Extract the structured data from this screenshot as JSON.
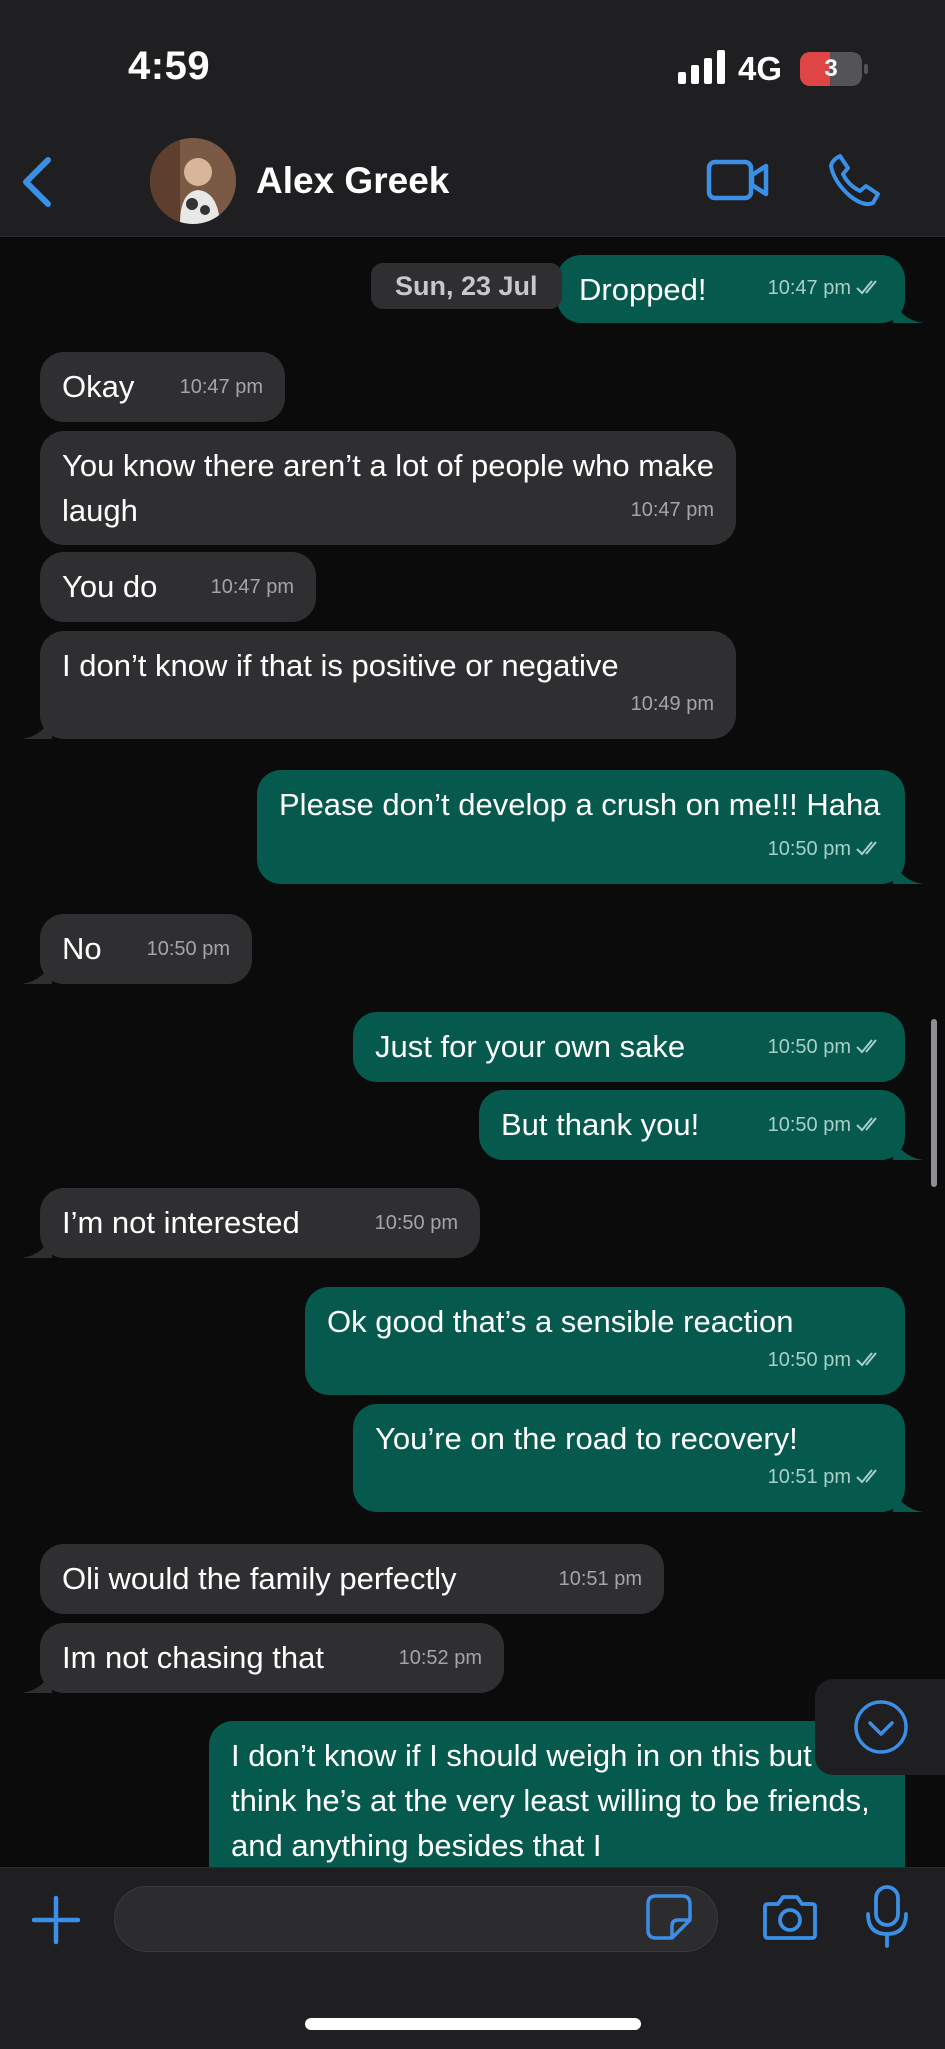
{
  "status_bar": {
    "time": "4:59",
    "network": "4G",
    "battery": "3"
  },
  "header": {
    "contact_name": "Alex Greek"
  },
  "date_divider": "Sun, 23 Jul",
  "messages": [
    {
      "text": "Dropped!",
      "time": "10:47 pm"
    },
    {
      "text": "Okay",
      "time": "10:47 pm"
    },
    {
      "text": "You know there aren’t a lot of people who make laugh",
      "time": "10:47 pm"
    },
    {
      "text": "You do",
      "time": "10:47 pm"
    },
    {
      "text": "I don’t know if that is positive  or negative",
      "time": "10:49 pm"
    },
    {
      "text": "Please don’t develop a crush on me!!! Haha",
      "time": "10:50 pm"
    },
    {
      "text": "No",
      "time": "10:50 pm"
    },
    {
      "text": "Just for your own sake",
      "time": "10:50 pm"
    },
    {
      "text": "But thank you!",
      "time": "10:50 pm"
    },
    {
      "text": "I’m not interested",
      "time": "10:50 pm"
    },
    {
      "text": "Ok good that’s a sensible reaction",
      "time": "10:50 pm"
    },
    {
      "text": "You’re on the road to recovery!",
      "time": "10:51 pm"
    },
    {
      "text": "Oli would the family perfectly",
      "time": "10:51 pm"
    },
    {
      "text": "Im not chasing that",
      "time": "10:52 pm"
    },
    {
      "text": "I don’t know if I should weigh in on this but I think he’s at the very least willing to be friends, and anything besides that I",
      "time": ""
    }
  ],
  "composer": {
    "placeholder": ""
  },
  "colors": {
    "accent": "#3a8fe6",
    "outgoing_bubble": "#055a4d",
    "incoming_bubble": "#2f2f31",
    "background": "#0b0b0c"
  }
}
